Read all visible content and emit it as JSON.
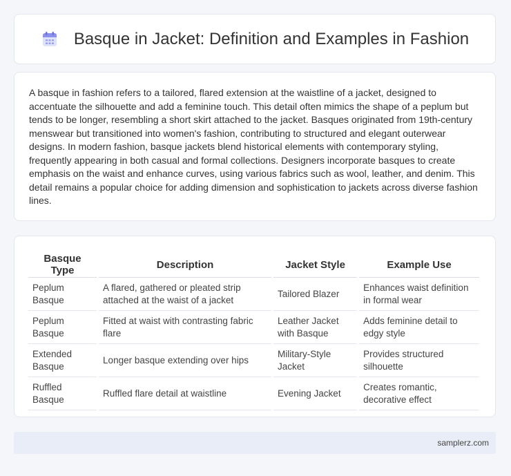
{
  "header": {
    "title": "Basque in Jacket: Definition and Examples in Fashion",
    "icon": "calendar-icon",
    "icon_color": "#7c83e6"
  },
  "intro": {
    "text": "A basque in fashion refers to a tailored, flared extension at the waistline of a jacket, designed to accentuate the silhouette and add a feminine touch. This detail often mimics the shape of a peplum but tends to be longer, resembling a short skirt attached to the jacket. Basques originated from 19th-century menswear but transitioned into women's fashion, contributing to structured and elegant outerwear designs. In modern fashion, basque jackets blend historical elements with contemporary styling, frequently appearing in both casual and formal collections. Designers incorporate basques to create emphasis on the waist and enhance curves, using various fabrics such as wool, leather, and denim. This detail remains a popular choice for adding dimension and sophistication to jackets across diverse fashion lines."
  },
  "table": {
    "headers": [
      "Basque Type",
      "Description",
      "Jacket Style",
      "Example Use"
    ],
    "rows": [
      [
        "Peplum Basque",
        "A flared, gathered or pleated strip attached at the waist of a jacket",
        "Tailored Blazer",
        "Enhances waist definition in formal wear"
      ],
      [
        "Peplum Basque",
        "Fitted at waist with contrasting fabric flare",
        "Leather Jacket with Basque",
        "Adds feminine detail to edgy style"
      ],
      [
        "Extended Basque",
        "Longer basque extending over hips",
        "Military-Style Jacket",
        "Provides structured silhouette"
      ],
      [
        "Ruffled Basque",
        "Ruffled flare detail at waistline",
        "Evening Jacket",
        "Creates romantic, decorative effect"
      ]
    ]
  },
  "footer": {
    "site": "samplerz.com"
  }
}
